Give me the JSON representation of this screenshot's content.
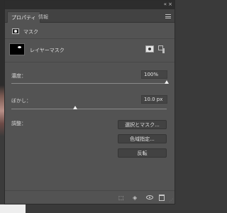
{
  "tabs": [
    {
      "label": "プロパティ",
      "active": true
    },
    {
      "label": "情報",
      "active": false
    }
  ],
  "subheader": {
    "title": "マスク"
  },
  "layer": {
    "label": "レイヤーマスク"
  },
  "density": {
    "label": "濃度：",
    "value": "100%",
    "level_percent": 100
  },
  "feather": {
    "label": "ぼかし：",
    "value": "10.0 px",
    "level_fraction": 0.41
  },
  "refine": {
    "label": "調整：",
    "buttons": [
      "選択とマスク...",
      "色域指定...",
      "反転"
    ]
  },
  "icons": {
    "collapse": "double-chevron-icon",
    "close": "close-icon",
    "menu": "panel-menu-icon",
    "mask": "mask-icon",
    "pixel_mask": "pixel-mask-icon",
    "vector_mask": "vector-mask-icon",
    "load_selection": "selection-dotted-icon",
    "apply_mask": "apply-mask-icon",
    "visibility": "eye-icon",
    "delete": "trash-icon"
  },
  "colors": {
    "panel": "#535353",
    "titlebar": "#2d2d2d",
    "tabbar": "#424242"
  }
}
